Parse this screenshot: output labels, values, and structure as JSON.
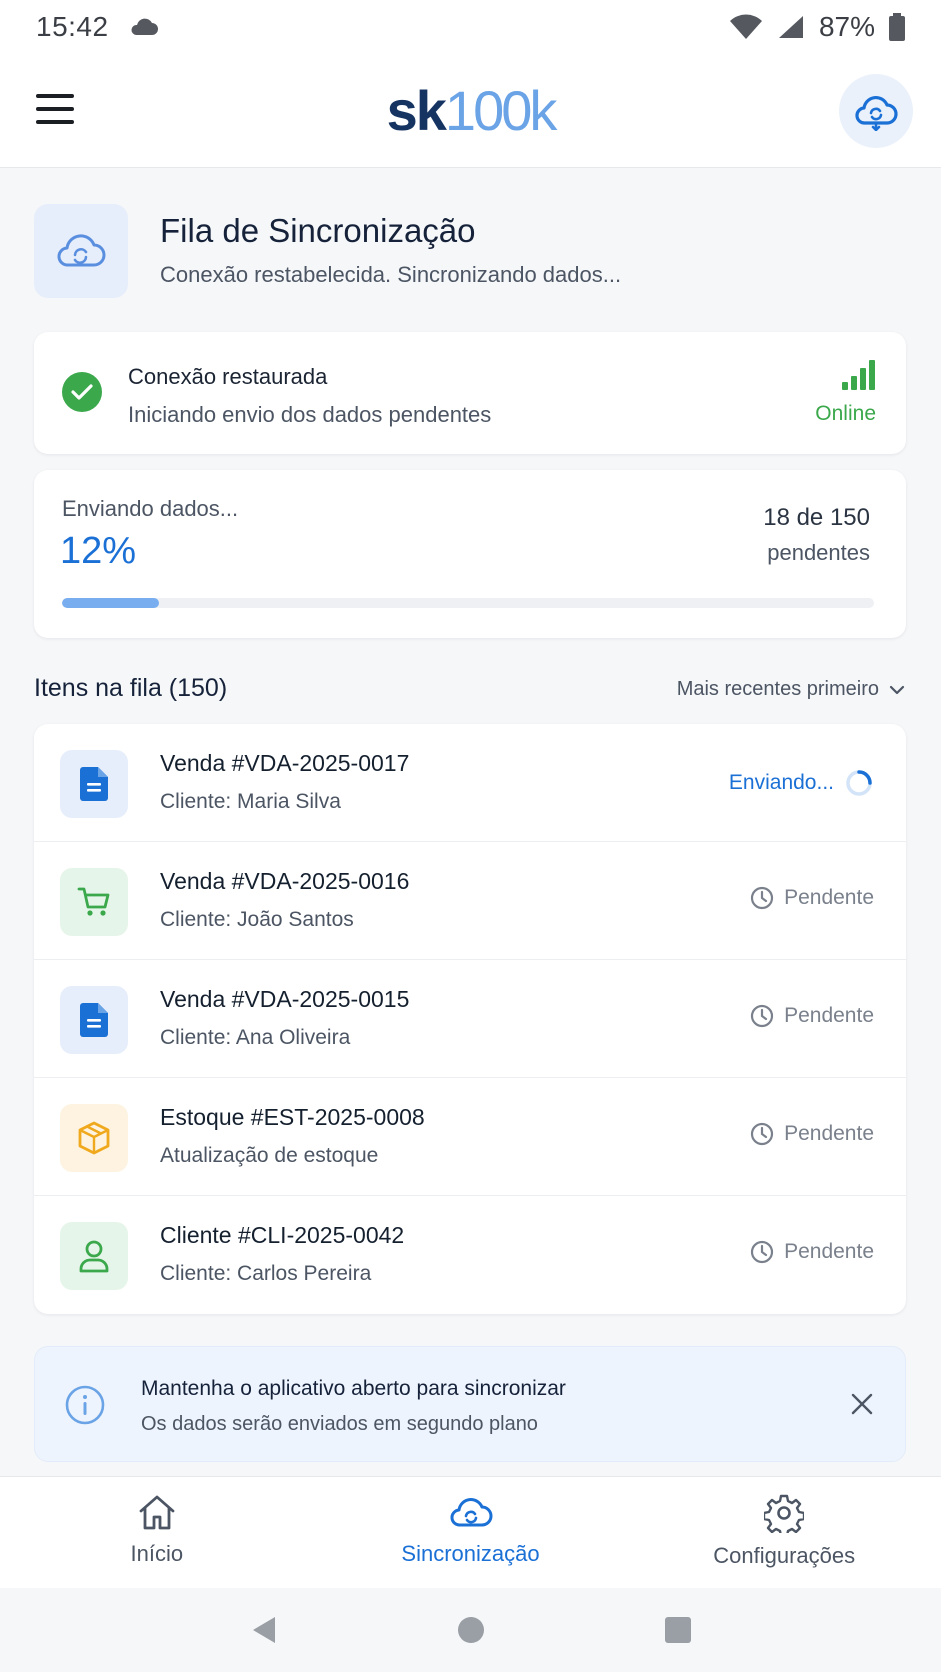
{
  "status_bar": {
    "time": "15:42",
    "battery": "87%"
  },
  "app_bar": {
    "logo_sk": "sk",
    "logo_num": "100k"
  },
  "hero": {
    "title": "Fila de Sincronização",
    "subtitle": "Conexão restabelecida. Sincronizando dados..."
  },
  "connection": {
    "title": "Conexão restaurada",
    "subtitle": "Iniciando envio dos dados pendentes",
    "status": "Online"
  },
  "progress": {
    "label": "Enviando dados...",
    "percent_text": "12%",
    "percent": 12,
    "count": "18 de 150",
    "pending_label": "pendentes"
  },
  "queue": {
    "heading": "Itens na fila (150)",
    "sort_label": "Mais recentes primeiro",
    "items": [
      {
        "title": "Venda #VDA-2025-0017",
        "subtitle": "Cliente: Maria Silva",
        "status": "Enviando...",
        "icon": "document-icon"
      },
      {
        "title": "Venda #VDA-2025-0016",
        "subtitle": "Cliente: João Santos",
        "status": "Pendente",
        "icon": "cart-icon"
      },
      {
        "title": "Venda #VDA-2025-0015",
        "subtitle": "Cliente: Ana Oliveira",
        "status": "Pendente",
        "icon": "document-icon"
      },
      {
        "title": "Estoque #EST-2025-0008",
        "subtitle": "Atualização de estoque",
        "status": "Pendente",
        "icon": "box-icon"
      },
      {
        "title": "Cliente #CLI-2025-0042",
        "subtitle": "Cliente: Carlos Pereira",
        "status": "Pendente",
        "icon": "user-icon"
      }
    ]
  },
  "info_banner": {
    "title": "Mantenha o aplicativo aberto para sincronizar",
    "subtitle": "Os dados serão enviados em segundo plano"
  },
  "bottom_nav": {
    "items": [
      {
        "label": "Início",
        "icon": "home-icon"
      },
      {
        "label": "Sincronização",
        "icon": "cloud-sync-icon"
      },
      {
        "label": "Configurações",
        "icon": "gear-icon"
      }
    ]
  },
  "colors": {
    "accent": "#1b70d6",
    "success": "#3aa84b",
    "brand_dark": "#163462",
    "brand_light": "#6aa3e6",
    "pending": "#7a818c"
  }
}
